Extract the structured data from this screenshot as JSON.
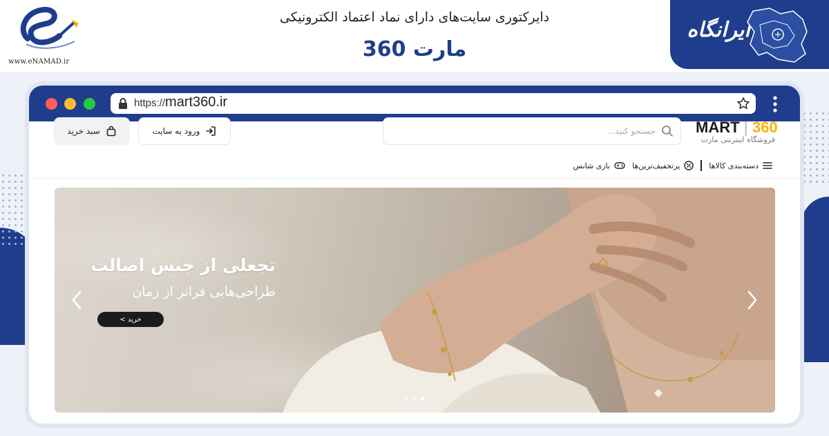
{
  "page": {
    "title": "دایرکتوری سایت‌های دارای نماد اعتماد الکترونیکی",
    "subtitle": "مارت 360",
    "enamad_url": "www.eNAMAD.ir",
    "badge_text": "ایرانگاه"
  },
  "colors": {
    "brand_blue": "#1f3d8c",
    "accent_yellow": "#f5b400",
    "hero_button": "#1b1b1b"
  },
  "browser": {
    "protocol": "https://",
    "domain": "mart360.ir",
    "icons": [
      "lock-icon",
      "star-icon",
      "kebab-menu-icon"
    ]
  },
  "site": {
    "logo": {
      "brand_text": "MART",
      "brand_number": "360",
      "tagline": "فروشگاه اینترنتی مارت"
    },
    "search": {
      "placeholder": "جستجو کنید..."
    },
    "login_label": "ورود به سایت",
    "cart_label": "سبد خرید",
    "nav": {
      "categories": "دسته‌بندی کالاها",
      "discounts": "پرتخفیف‌ترین‌ها",
      "lucky_game": "بازی شانس"
    },
    "hero": {
      "title": "تجعلی از جنس اصالت",
      "subtitle": "طراحی‌هایی فراتر از زمان",
      "button": "خرید >",
      "slides": 3,
      "active_slide": 3
    }
  }
}
